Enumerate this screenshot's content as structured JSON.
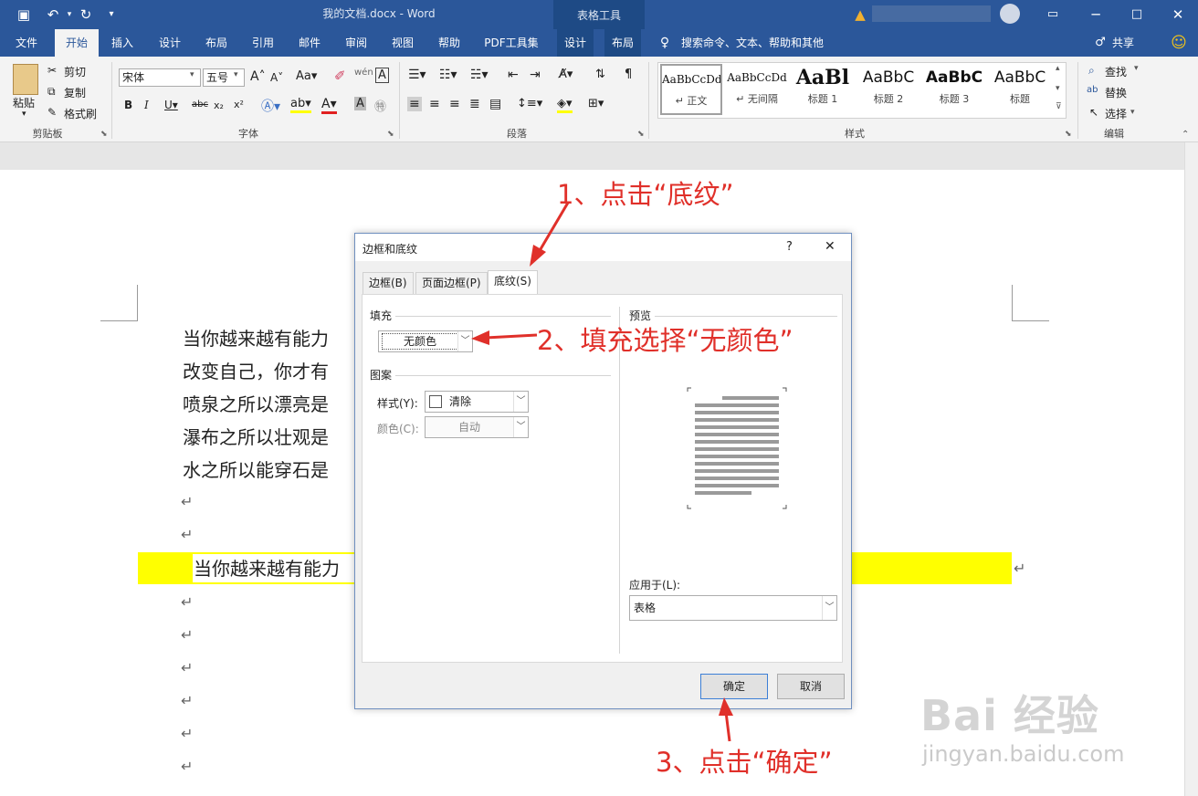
{
  "titlebar": {
    "doc_title": "我的文档.docx  -  Word",
    "context_title": "表格工具"
  },
  "tabs": [
    "文件",
    "开始",
    "插入",
    "设计",
    "布局",
    "引用",
    "邮件",
    "审阅",
    "视图",
    "帮助",
    "PDF工具集",
    "设计",
    "布局"
  ],
  "tell_me": "搜索命令、文本、帮助和其他",
  "share": "共享",
  "clipboard": {
    "paste": "粘贴",
    "cut": "剪切",
    "copy": "复制",
    "format_painter": "格式刷",
    "label": "剪贴板"
  },
  "font": {
    "name": "宋体",
    "size": "五号",
    "label": "字体"
  },
  "paragraph": {
    "label": "段落"
  },
  "styles": {
    "label": "样式",
    "items": [
      {
        "sample": "AaBbCcDd",
        "name": "↵ 正文"
      },
      {
        "sample": "AaBbCcDd",
        "name": "↵ 无间隔"
      },
      {
        "sample": "AaBl",
        "name": "标题 1"
      },
      {
        "sample": "AaBbC",
        "name": "标题 2"
      },
      {
        "sample": "AaBbC",
        "name": "标题 3"
      },
      {
        "sample": "AaBbC",
        "name": "标题"
      }
    ]
  },
  "editing": {
    "find": "查找",
    "replace": "替换",
    "select": "选择",
    "label": "编辑"
  },
  "document": {
    "lines": [
      "当你越来越有能力",
      "改变自己，你才有",
      "喷泉之所以漂亮是",
      "瀑布之所以壮观是",
      "水之所以能穿石是"
    ],
    "highlight_text": "当你越来越有能力",
    "para_mark": "↵"
  },
  "dialog": {
    "title": "边框和底纹",
    "help": "?",
    "close": "✕",
    "tabs": [
      "边框(B)",
      "页面边框(P)",
      "底纹(S)"
    ],
    "fill_label": "填充",
    "fill_value": "无颜色",
    "pattern_label": "图案",
    "style_label": "样式(Y):",
    "style_value": "清除",
    "color_label": "颜色(C):",
    "color_value": "自动",
    "preview_label": "预览",
    "apply_label": "应用于(L):",
    "apply_value": "表格",
    "ok": "确定",
    "cancel": "取消"
  },
  "annotations": {
    "step1": "1、点击“底纹”",
    "step2": "2、填充选择“无颜色”",
    "step3": "3、点击“确定”"
  },
  "watermark": {
    "brand": "Bai 经验",
    "url": "jingyan.baidu.com"
  },
  "colors": {
    "word_blue": "#2b579a",
    "highlight": "#ffff00",
    "annotation_red": "#e0302a"
  }
}
